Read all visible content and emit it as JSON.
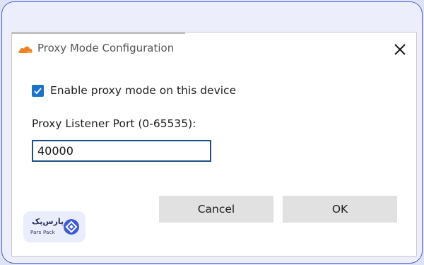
{
  "dialog": {
    "title": "Proxy Mode Configuration",
    "title_icon": "cloudflare-cloud-icon",
    "close_icon": "close-icon"
  },
  "form": {
    "enable_checkbox": {
      "label": "Enable proxy mode on this device",
      "checked": true
    },
    "port_label": "Proxy Listener Port (0-65535):",
    "port_value": "40000"
  },
  "buttons": {
    "cancel_label": "Cancel",
    "ok_label": "OK"
  },
  "watermark": {
    "name_fa": "پارس‌پک",
    "name_en": "Pars Pack",
    "icon": "parspack-logo-icon"
  },
  "colors": {
    "accent": "#1a73c8",
    "frame_border": "#4f5fd6",
    "cloud_orange": "#f38020"
  }
}
